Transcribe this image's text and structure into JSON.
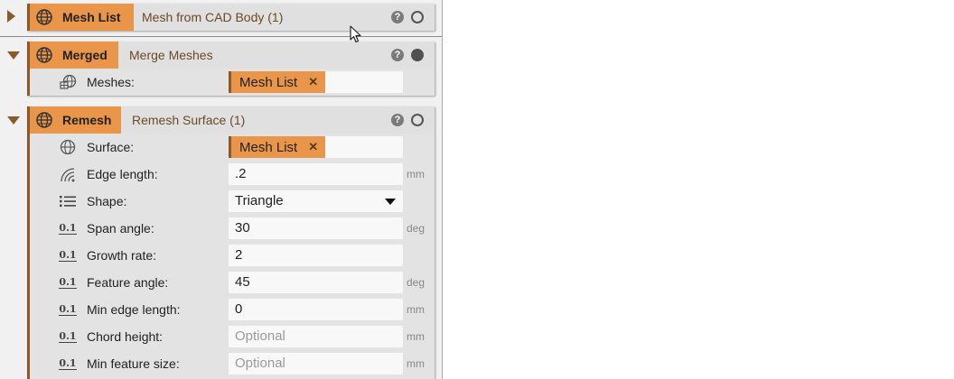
{
  "nodes": {
    "mesh_list": {
      "name": "Mesh List",
      "subtitle": "Mesh from CAD Body (1)",
      "help": "?"
    },
    "merged": {
      "name": "Merged",
      "subtitle": "Merge Meshes",
      "help": "?",
      "rows": {
        "meshes": {
          "label": "Meshes:",
          "chip": "Mesh List",
          "chip_remove": "✕"
        }
      }
    },
    "remesh": {
      "name": "Remesh",
      "subtitle": "Remesh Surface (1)",
      "help": "?",
      "rows": {
        "surface": {
          "label": "Surface:",
          "chip": "Mesh List",
          "chip_remove": "✕"
        },
        "edge_length": {
          "label": "Edge length:",
          "value": ".2",
          "unit": "mm"
        },
        "shape": {
          "label": "Shape:",
          "value": "Triangle"
        },
        "span_angle": {
          "label": "Span angle:",
          "value": "30",
          "unit": "deg"
        },
        "growth_rate": {
          "label": "Growth rate:",
          "value": "2"
        },
        "feature_angle": {
          "label": "Feature angle:",
          "value": "45",
          "unit": "deg"
        },
        "min_edge_length": {
          "label": "Min edge length:",
          "value": "0",
          "unit": "mm"
        },
        "chord_height": {
          "label": "Chord height:",
          "placeholder": "Optional",
          "unit": "mm"
        },
        "min_feature_size": {
          "label": "Min feature size:",
          "placeholder": "Optional",
          "unit": "mm"
        }
      }
    }
  },
  "icons": {
    "node": "globe-mesh-icon",
    "merge": "merge-meshes-icon",
    "surface": "globe-icon",
    "edge": "edge-length-icon",
    "list": "list-icon",
    "numeric": "numeric-value-icon"
  },
  "numeric_icon_text": "0.1",
  "colors": {
    "node_accent": "#e9954a",
    "node_border": "#8b5a2b",
    "panel_bg": "#f1f1f1"
  }
}
